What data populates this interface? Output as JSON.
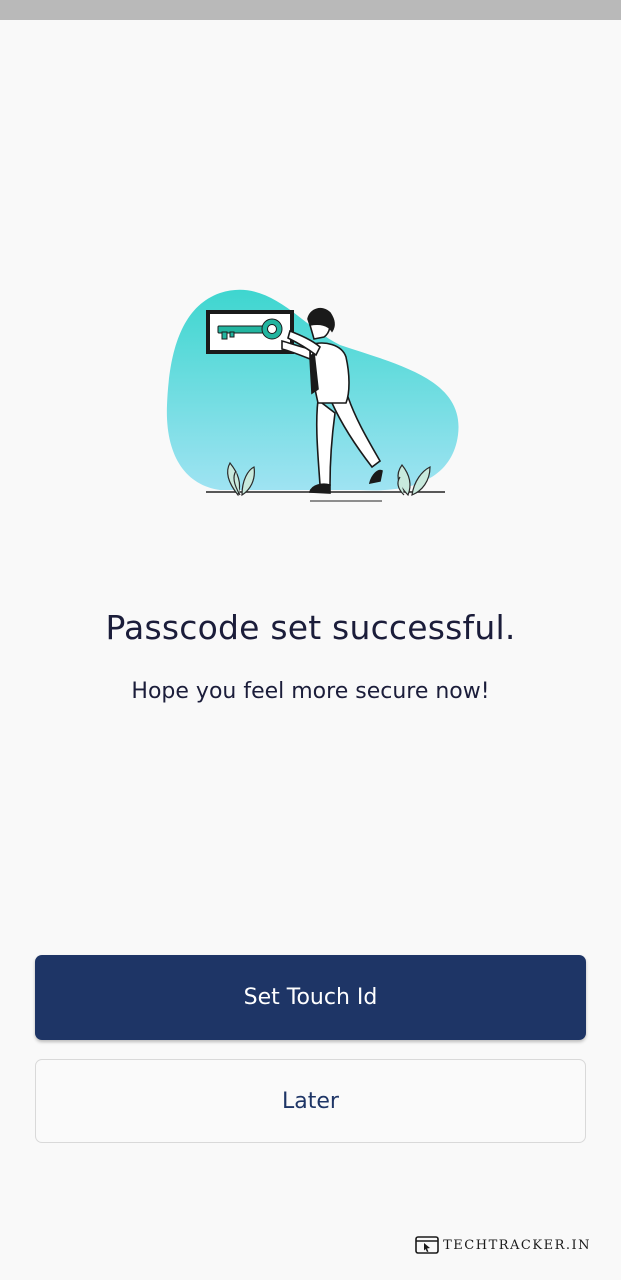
{
  "status_bar": {},
  "illustration": {
    "icon": "person-holding-key-frame-illustration",
    "colors": {
      "blob_top": "#3ed6cf",
      "blob_bottom": "#9fe3f2",
      "key": "#22b5a0",
      "frame": "#1a1a1a"
    }
  },
  "message": {
    "title": "Passcode set successful.",
    "subtitle": "Hope you feel more secure now!"
  },
  "actions": {
    "primary_label": "Set Touch Id",
    "secondary_label": "Later"
  },
  "watermark": {
    "icon": "browser-cursor-icon",
    "text": "TECHTRACKER.IN"
  },
  "colors": {
    "background": "#f9f9f9",
    "primary_button": "#1e3566",
    "primary_text": "#ffffff",
    "heading_text": "#1b1d3a"
  }
}
